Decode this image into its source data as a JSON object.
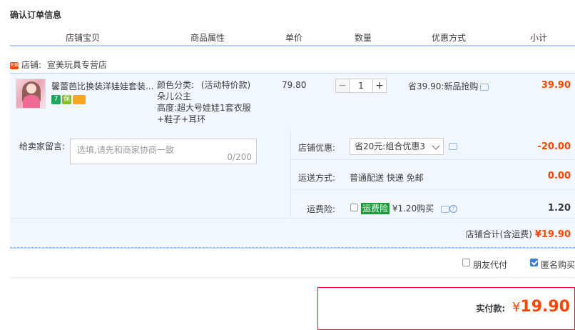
{
  "page_title": "确认订单信息",
  "columns": [
    "店铺宝贝",
    "商品属性",
    "单价",
    "数量",
    "优惠方式",
    "小计"
  ],
  "shop": {
    "badge": "天猫",
    "label": "店铺:",
    "name": "宣美玩具专营店"
  },
  "item": {
    "title": "馨蕾芭比换装洋娃娃套装...",
    "tags": [
      {
        "text": "7",
        "color": "#1ea65a"
      },
      {
        "text": "保",
        "color": "#85bd22"
      },
      {
        "text": "▬",
        "color": "#f5a623"
      }
    ],
    "attr_color_label": "颜色分类:",
    "attr_color_note": "(活动特价款)",
    "attr_color_value": "朵儿公主",
    "attr_height": "高度:超大号娃娃1套衣服",
    "attr_height_2": "+鞋子+耳环",
    "price": "79.80",
    "quantity": "1",
    "qty_minus": "−",
    "qty_plus": "+",
    "promotion": "省39.90:新品抢购",
    "subtotal": "39.90"
  },
  "memo": {
    "label": "给卖家留言:",
    "placeholder": "选填,请先和商家协商一致",
    "counter": "0/200"
  },
  "shop_discount": {
    "label": "店铺优惠:",
    "selected": "省20元:组合优惠3",
    "amount": "-20.00"
  },
  "shipping": {
    "label": "运送方式:",
    "method": "普通配送 快递 免邮",
    "amount": "0.00"
  },
  "insurance": {
    "label": "运费险:",
    "badge": "运费险",
    "price": "¥1.20购买",
    "help": "?",
    "amount": "1.20",
    "checked": false
  },
  "shop_total": {
    "label": "店铺合计(含运费)",
    "amount": "¥19.90"
  },
  "options": {
    "friend_pay": {
      "label": "朋友代付",
      "checked": false
    },
    "anonymous": {
      "label": "匿名购买",
      "checked": true
    }
  },
  "payment": {
    "label": "实付款:",
    "currency": "¥",
    "amount": "19.90"
  },
  "colors": {
    "accent_red": "#ff4400",
    "header_line": "#b2d1ff",
    "row_bg": "#f2f7ff",
    "pay_border": "#ff0036"
  }
}
